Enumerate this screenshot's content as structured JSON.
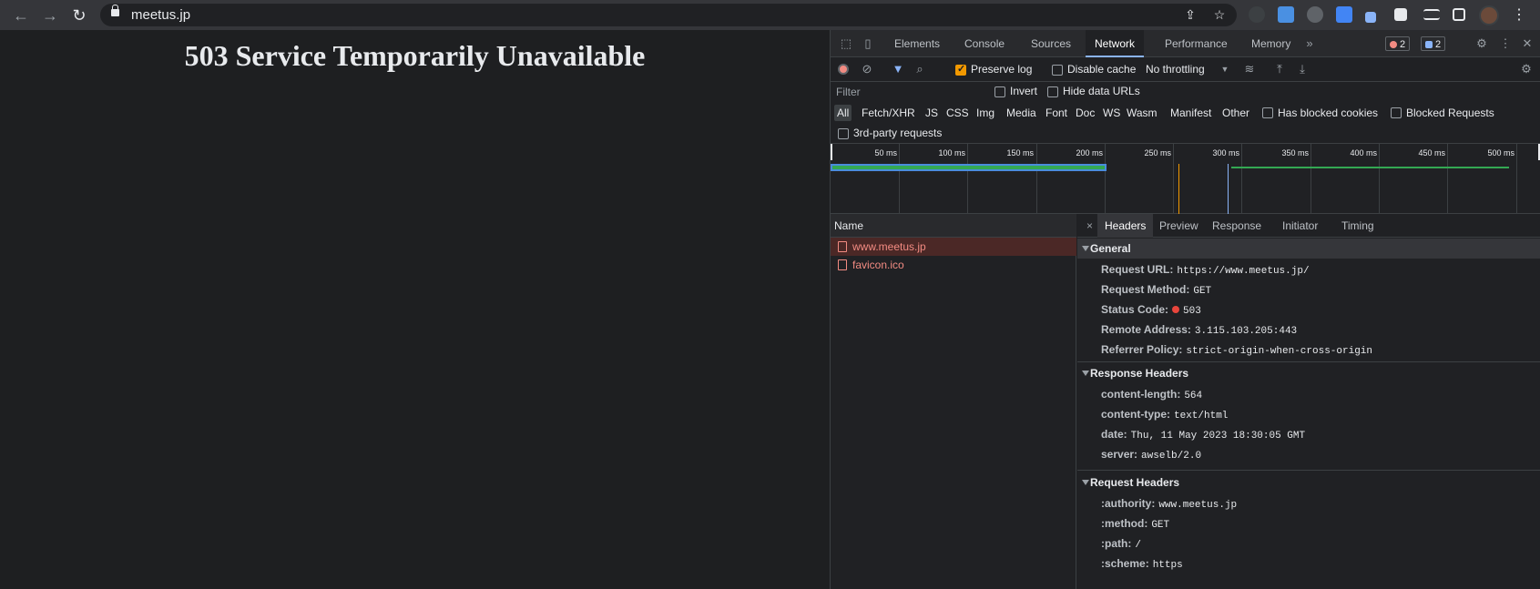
{
  "browser": {
    "url": "meetus.jp",
    "icons": [
      "back-icon",
      "forward-icon",
      "reload-icon",
      "lock-icon",
      "share-icon",
      "star-icon"
    ]
  },
  "page": {
    "title": "503 Service Temporarily Unavailable"
  },
  "devtools": {
    "tabs": [
      "Elements",
      "Console",
      "Sources",
      "Network",
      "Performance",
      "Memory"
    ],
    "active_tab": "Network",
    "more": "»",
    "error_count": "2",
    "message_count": "2",
    "toolbar": {
      "preserve_log": "Preserve log",
      "preserve_log_checked": true,
      "disable_cache": "Disable cache",
      "throttling": "No throttling"
    },
    "filter": {
      "placeholder": "Filter",
      "invert": "Invert",
      "hide_data_urls": "Hide data URLs"
    },
    "types": [
      "All",
      "Fetch/XHR",
      "JS",
      "CSS",
      "Img",
      "Media",
      "Font",
      "Doc",
      "WS",
      "Wasm",
      "Manifest",
      "Other"
    ],
    "active_type": "All",
    "has_blocked_cookies": "Has blocked cookies",
    "blocked_requests": "Blocked Requests",
    "third_party": "3rd-party requests",
    "timeline_ticks": [
      "50 ms",
      "100 ms",
      "150 ms",
      "200 ms",
      "250 ms",
      "300 ms",
      "350 ms",
      "400 ms",
      "450 ms",
      "500 ms"
    ],
    "requests": {
      "header": "Name",
      "rows": [
        "www.meetus.jp",
        "favicon.ico"
      ]
    },
    "details": {
      "close": "×",
      "tabs": [
        "Headers",
        "Preview",
        "Response",
        "Initiator",
        "Timing"
      ],
      "active_tab": "Headers",
      "general": {
        "title": "General",
        "rows": [
          {
            "k": "Request URL:",
            "v": "https://www.meetus.jp/"
          },
          {
            "k": "Request Method:",
            "v": "GET"
          },
          {
            "k": "Status Code:",
            "v": "503"
          },
          {
            "k": "Remote Address:",
            "v": "3.115.103.205:443"
          },
          {
            "k": "Referrer Policy:",
            "v": "strict-origin-when-cross-origin"
          }
        ]
      },
      "response_headers": {
        "title": "Response Headers",
        "rows": [
          {
            "k": "content-length:",
            "v": "564"
          },
          {
            "k": "content-type:",
            "v": "text/html"
          },
          {
            "k": "date:",
            "v": "Thu, 11 May 2023 18:30:05 GMT"
          },
          {
            "k": "server:",
            "v": "awselb/2.0"
          }
        ]
      },
      "request_headers": {
        "title": "Request Headers",
        "rows": [
          {
            "k": ":authority:",
            "v": "www.meetus.jp"
          },
          {
            "k": ":method:",
            "v": "GET"
          },
          {
            "k": ":path:",
            "v": "/"
          },
          {
            "k": ":scheme:",
            "v": "https"
          }
        ]
      }
    }
  },
  "colors": {
    "error": "#f28b82",
    "accent": "#8ab4f8",
    "checkbox": "#f29900"
  }
}
